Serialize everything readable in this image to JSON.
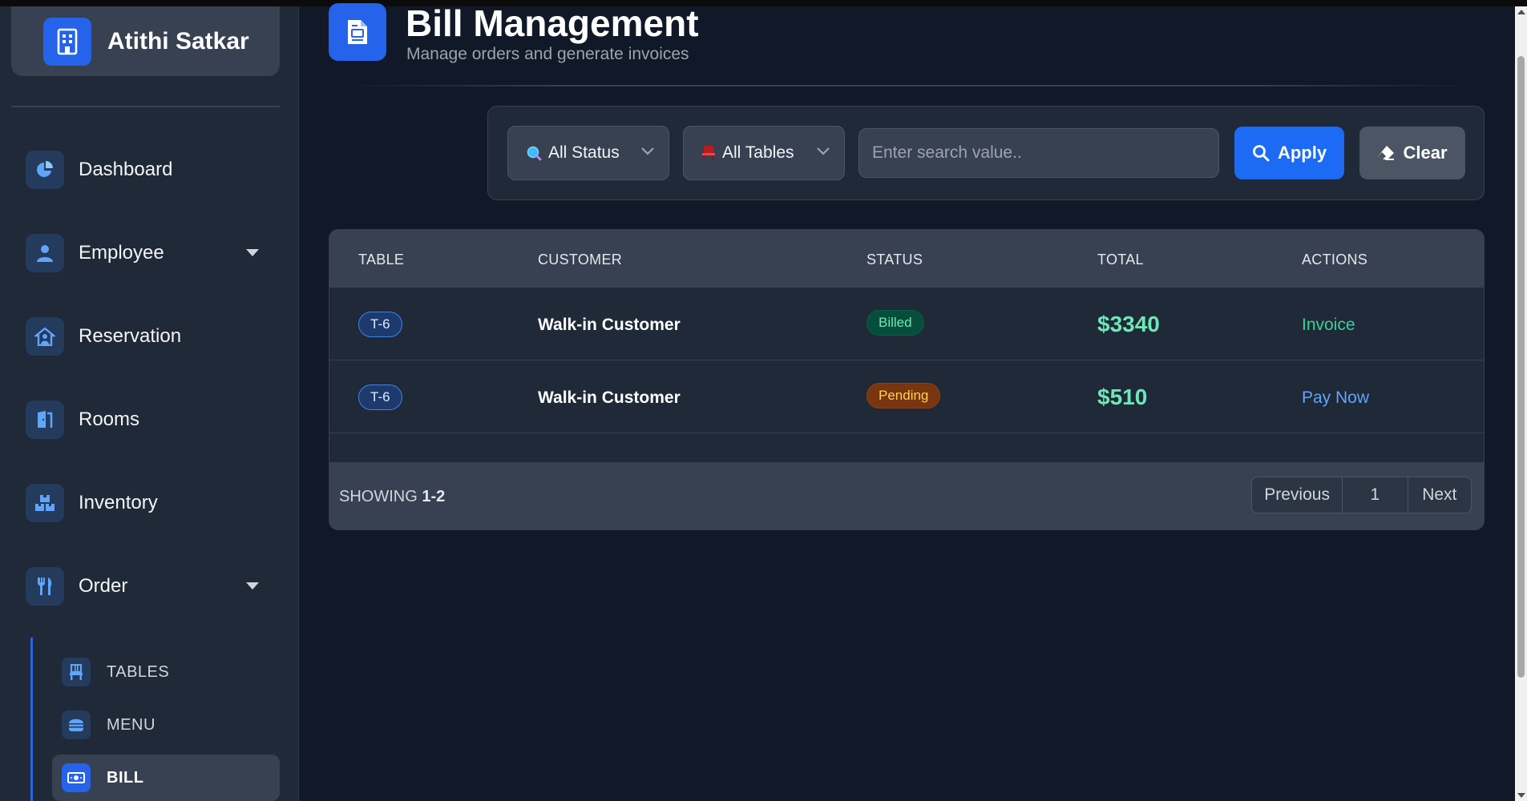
{
  "app": {
    "brand_name": "Atithi Satkar",
    "brand_icon": "building-icon"
  },
  "sidebar": {
    "items": [
      {
        "label": "Dashboard",
        "icon": "pie-chart-icon"
      },
      {
        "label": "Employee",
        "icon": "user-icon",
        "expandable": true
      },
      {
        "label": "Reservation",
        "icon": "house-user-icon"
      },
      {
        "label": "Rooms",
        "icon": "door-icon"
      },
      {
        "label": "Inventory",
        "icon": "boxes-icon"
      },
      {
        "label": "Order",
        "icon": "utensils-icon",
        "expandable": true,
        "expanded": true
      }
    ],
    "sub_items": [
      {
        "label": "TABLES",
        "icon": "chair-icon"
      },
      {
        "label": "MENU",
        "icon": "burger-icon"
      },
      {
        "label": "BILL",
        "icon": "money-bill-icon",
        "active": true
      }
    ]
  },
  "header": {
    "title": "Bill Management",
    "subtitle": "Manage orders and generate invoices",
    "icon": "file-invoice-icon"
  },
  "filters": {
    "status": {
      "selected": "All Status",
      "icon": "search-dot-icon"
    },
    "tables": {
      "selected": "All Tables",
      "icon": "chair-icon"
    },
    "search": {
      "placeholder": "Enter search value..",
      "value": ""
    },
    "apply_label": "Apply",
    "clear_label": "Clear"
  },
  "table": {
    "columns": [
      "TABLE",
      "CUSTOMER",
      "STATUS",
      "TOTAL",
      "ACTIONS"
    ],
    "rows": [
      {
        "table": "T-6",
        "customer": "Walk-in Customer",
        "status": "Billed",
        "total": "$3340",
        "action": "Invoice"
      },
      {
        "table": "T-6",
        "customer": "Walk-in Customer",
        "status": "Pending",
        "total": "$510",
        "action": "Pay Now"
      }
    ],
    "showing_prefix": "SHOWING",
    "showing_range": "1-2",
    "pagination": {
      "previous": "Previous",
      "current_page": "1",
      "next": "Next"
    }
  },
  "colors": {
    "accent": "#2563eb",
    "background": "#111827",
    "sidebar": "#1f2937",
    "billed": "#6ee7b7",
    "pending": "#fcd34d",
    "pay_link": "#60a5fa"
  }
}
